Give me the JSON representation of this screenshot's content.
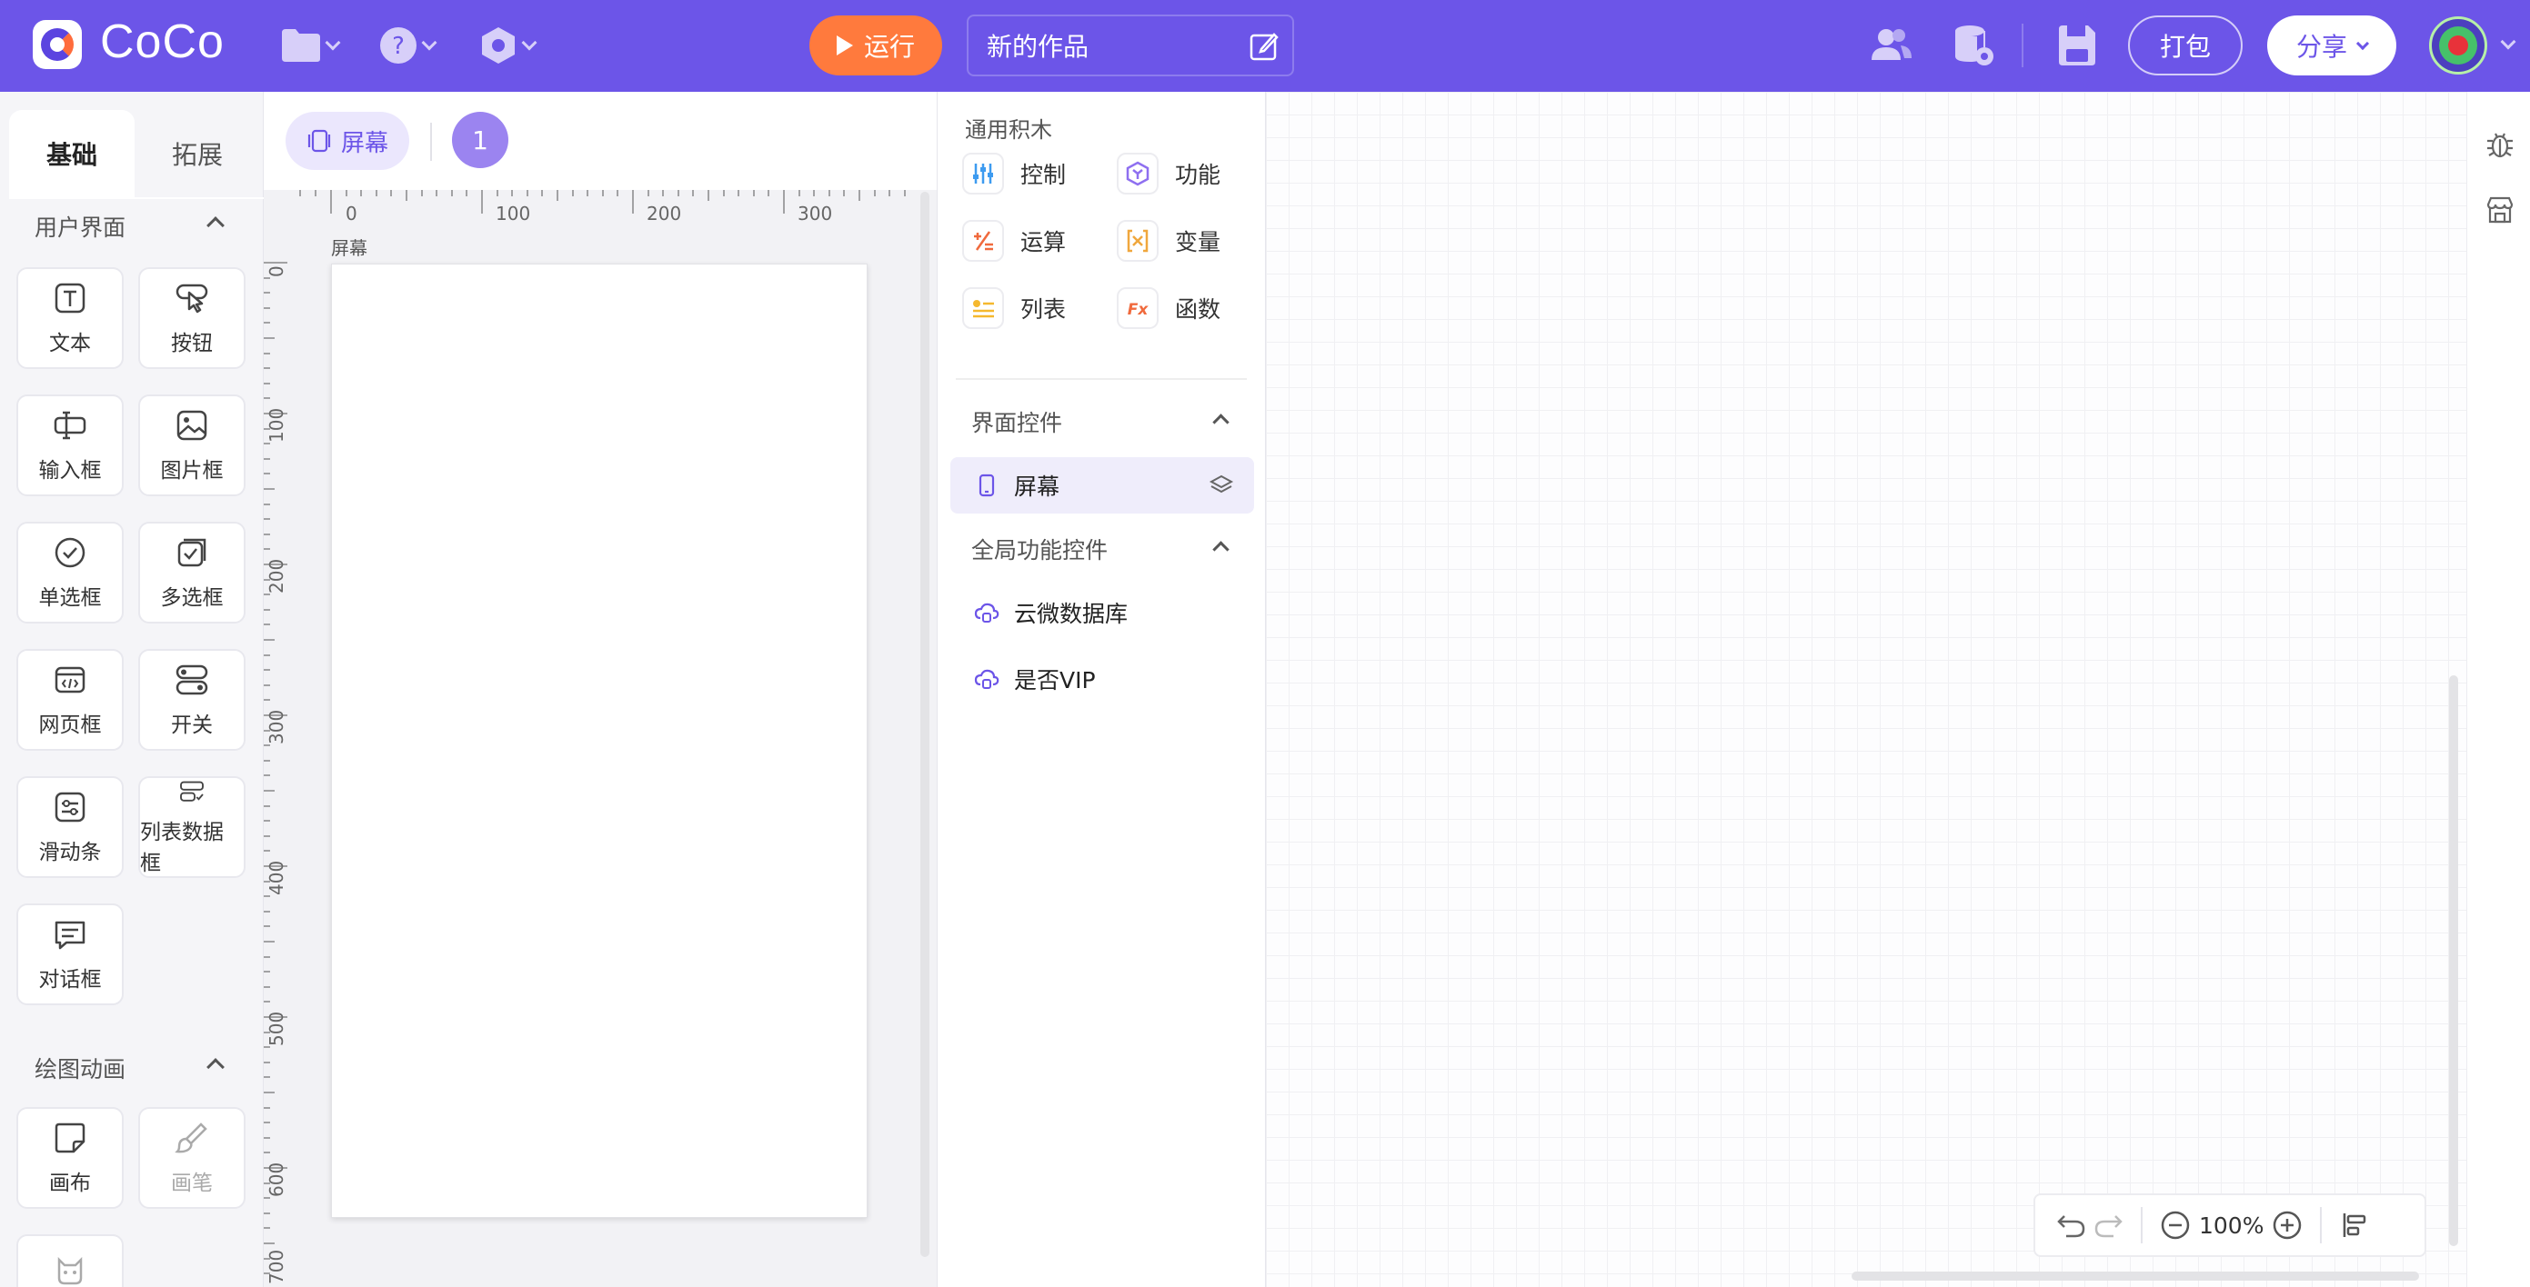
{
  "app": {
    "brand": "CoCo"
  },
  "topbar": {
    "icons": [
      "folder-icon",
      "help-icon",
      "settings-hex-icon"
    ],
    "run_label": "运行",
    "project_title": "新的作品",
    "right_icons": [
      "collaborators-icon",
      "database-settings-icon",
      "save-icon"
    ],
    "pack_label": "打包",
    "share_label": "分享"
  },
  "left_panel": {
    "tabs": [
      "基础",
      "拓展"
    ],
    "section_ui": "用户界面",
    "components_ui": [
      {
        "label": "文本",
        "icon": "text-icon"
      },
      {
        "label": "按钮",
        "icon": "button-tap-icon"
      },
      {
        "label": "输入框",
        "icon": "input-icon"
      },
      {
        "label": "图片框",
        "icon": "image-icon"
      },
      {
        "label": "单选框",
        "icon": "radio-icon"
      },
      {
        "label": "多选框",
        "icon": "checkbox-icon"
      },
      {
        "label": "网页框",
        "icon": "webview-icon"
      },
      {
        "label": "开关",
        "icon": "switch-icon"
      },
      {
        "label": "滑动条",
        "icon": "slider-icon"
      },
      {
        "label": "列表数据框",
        "icon": "list-data-icon"
      },
      {
        "label": "对话框",
        "icon": "dialog-icon"
      }
    ],
    "section_draw": "绘图动画",
    "components_draw": [
      {
        "label": "画布",
        "icon": "canvas-icon"
      },
      {
        "label": "画笔",
        "icon": "brush-icon"
      }
    ]
  },
  "canvas": {
    "chip_label": "屏幕",
    "screen_count": "1",
    "screen_label": "屏幕",
    "ruler_top": [
      "0",
      "100",
      "200",
      "300"
    ],
    "ruler_left": [
      "0",
      "100",
      "200",
      "300",
      "400",
      "500",
      "600",
      "700"
    ]
  },
  "blocks_panel": {
    "title": "通用积木",
    "categories": [
      {
        "label": "控制",
        "icon": "control-icon",
        "color": "#3d9bf0"
      },
      {
        "label": "功能",
        "icon": "function-cube-icon",
        "color": "#8e6ff0"
      },
      {
        "label": "运算",
        "icon": "operator-icon",
        "color": "#f06a3d"
      },
      {
        "label": "变量",
        "icon": "variable-icon",
        "color": "#f0a73d"
      },
      {
        "label": "列表",
        "icon": "list-icon",
        "color": "#f5b82e"
      },
      {
        "label": "函数",
        "icon": "fx-icon",
        "color": "#f06a3d"
      }
    ],
    "section_ui": "界面控件",
    "ui_items": [
      {
        "label": "屏幕"
      }
    ],
    "section_global": "全局功能控件",
    "global_items": [
      {
        "label": "云微数据库"
      },
      {
        "label": "是否VIP"
      }
    ]
  },
  "workspace": {
    "zoom": "100%"
  },
  "colors": {
    "primary": "#6c55e8",
    "run": "#ff7a3d"
  }
}
